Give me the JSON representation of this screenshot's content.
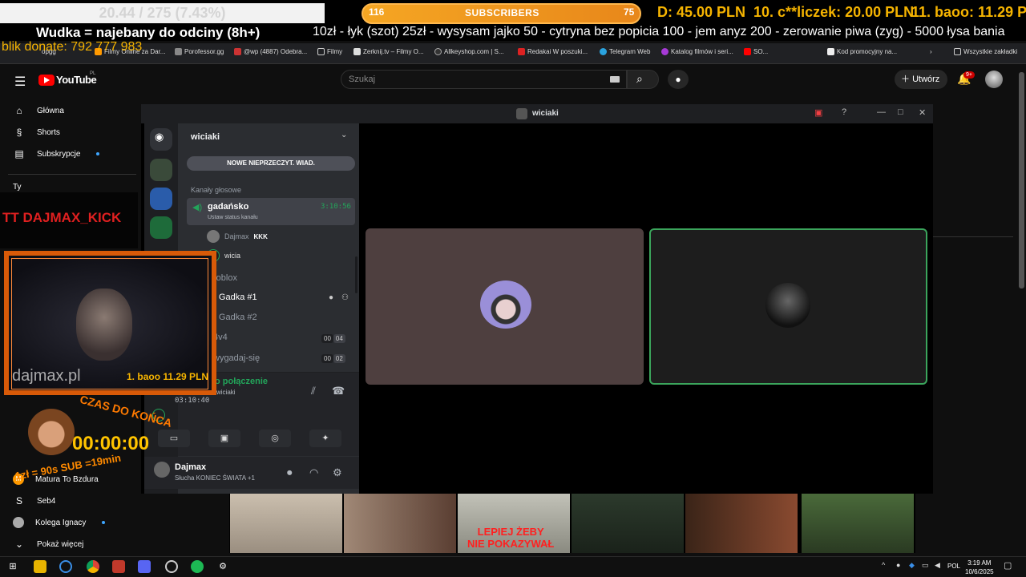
{
  "overlay": {
    "donate_box": "20.44 / 275 (7.43%)",
    "subs_current": "116",
    "subs_title": "SUBSCRIBERS",
    "subs_goal": "75",
    "subs_progress": 1.0,
    "top_donors": [
      {
        "rank": "",
        "name": "D",
        "amount": "45.00 PLN"
      },
      {
        "rank": "10.",
        "name": "c**liczek",
        "amount": "20.00 PLN"
      },
      {
        "rank": "11.",
        "name": "baoo",
        "amount": "11.29 PLN"
      }
    ],
    "wudka": "Wudka = najebany do odciny (8h+)",
    "ticker": "10zł - łyk (szot) 25zł - wysysam jajko  50 - cytryna bez popicia 100 - jem anyz 200 - zerowanie piwa (zyg) - 5000 łysa bania",
    "blik": "blik donate: 792 777 983",
    "tt_label": "TT DAJMAX_KICK",
    "cam_watermark": "dajmax.pl",
    "cam_donor_rank": "1.",
    "cam_donor": "baoo  11.29 PLN",
    "countdown_title": "CZAS DO KOŃCA",
    "countdown": "00:00:00",
    "countdown_rule": "1zł = 90s SUB =19min",
    "strip_text": "LEPIEJ ŻEBY\nNIE POKAZYWAŁ"
  },
  "bookmarks": [
    "opgg",
    "Filmy Online za Dar...",
    "Porofessor.gg",
    "@wp (4887) Odebra...",
    "Filmy",
    "Zerknij.tv – Filmy O...",
    "Allkeyshop.com | S...",
    "Redakai W poszuki...",
    "Telegram Web",
    "Katalog filmów i seri...",
    "SO...",
    "Kod promocyjny na...",
    "Wszystkie zakładki"
  ],
  "youtube": {
    "logo": "YouTube",
    "locale": "PL",
    "search_placeholder": "Szukaj",
    "create_label": "Utwórz",
    "notif_count": "9+",
    "nav": [
      {
        "label": "Główna",
        "icon": "home-icon"
      },
      {
        "label": "Shorts",
        "icon": "shorts-icon"
      },
      {
        "label": "Subskrypcje",
        "icon": "subscriptions-icon"
      }
    ],
    "you_label": "Ty",
    "subscriptions": [
      "Matura To Bzdura",
      "Seb4",
      "Kolega Ignacy"
    ],
    "show_more": "Pokaż więcej"
  },
  "discord": {
    "window_title": "wiciaki",
    "server_name": "wiciaki",
    "new_messages": "NOWE NIEPRZECZYT. WIAD.",
    "category": "Kanały głosowe",
    "active_channel": "gadańsko",
    "active_channel_sub": "Ustaw status kanału",
    "active_channel_time": "3:10:56",
    "users": [
      {
        "name": "Dajmax",
        "tag": "KKK"
      },
      {
        "name": "wicia",
        "tag": ""
      }
    ],
    "channels": [
      {
        "name": "roblox",
        "counts": []
      },
      {
        "name": "Gadka #1",
        "counts": []
      },
      {
        "name": "Gadka #2",
        "counts": []
      },
      {
        "name": "4v4",
        "counts": [
          "00",
          "04"
        ]
      },
      {
        "name": "wygadaj-się",
        "counts": [
          "00",
          "02"
        ]
      }
    ],
    "voice_connected": "o połączenie",
    "voice_server": "wiciaki",
    "voice_time": "03:10:40",
    "username": "Dajmax",
    "user_status": "Słucha KONIEC ŚWIATA +1"
  },
  "taskbar": {
    "lang": "POL",
    "time": "3:19 AM",
    "date": "10/6/2025"
  }
}
